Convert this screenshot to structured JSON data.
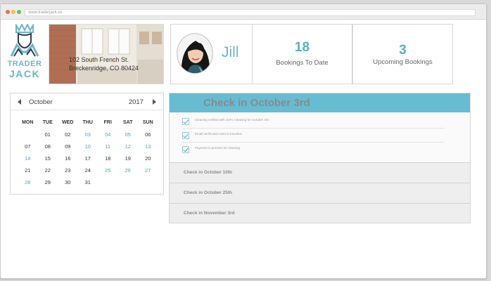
{
  "browser": {
    "url": "www.traderjack.us",
    "dots": [
      "#ee6a5f",
      "#f5bd4f",
      "#61c454"
    ]
  },
  "logo": {
    "line1": "TRADER",
    "line2": "JACK",
    "color": "#6ab6c8"
  },
  "property": {
    "address_line1": "102 South French St.",
    "address_line2": "Breckenridge, CO 80424"
  },
  "profile": {
    "name": "Jill"
  },
  "stats": [
    {
      "value": "18",
      "label": "Bookings To Date"
    },
    {
      "value": "3",
      "label": "Upcoming Bookings"
    }
  ],
  "calendar": {
    "month": "October",
    "year": "2017",
    "weekdays": [
      "MON",
      "TUE",
      "WED",
      "THU",
      "FRI",
      "SAT",
      "SUN"
    ],
    "weeks": [
      [
        "",
        "01",
        "02",
        "03",
        "04",
        "05",
        "06"
      ],
      [
        "07",
        "08",
        "09",
        "10",
        "11",
        "12",
        "13"
      ],
      [
        "14",
        "15",
        "16",
        "17",
        "18",
        "19",
        "20"
      ],
      [
        "21",
        "22",
        "23",
        "24",
        "25",
        "26",
        "27"
      ],
      [
        "28",
        "29",
        "30",
        "31",
        "",
        "",
        ""
      ]
    ],
    "highlighted": [
      "03",
      "04",
      "05",
      "10",
      "11",
      "12",
      "13",
      "14",
      "25",
      "26",
      "27",
      "28"
    ]
  },
  "checkins": {
    "active_title": "Check in October 3rd",
    "tasks": [
      "Cleaning verified with Joe's Cleaning for October 3rd",
      "Email verification sent to travelers",
      "Payment in process for cleaning"
    ],
    "collapsed": [
      "Check in October 10th",
      "Check in October 25th",
      "Check in November 3rd"
    ]
  },
  "colors": {
    "accent": "#6ab6c8",
    "header_bar": "#66bcd0"
  }
}
